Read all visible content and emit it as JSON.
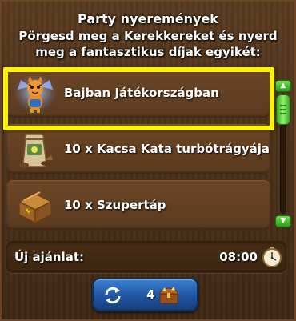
{
  "header": {
    "title": "Party nyeremények",
    "subtitle": "Pörgesd meg a Kerekkereket és nyerd meg a fantasztikus díjak egyikét:"
  },
  "prizes": [
    {
      "label": "Bajban Játékországban",
      "icon": "tiger-costume-icon",
      "selected": true
    },
    {
      "label": "10 x Kacsa Kata turbótrágyája",
      "icon": "fertilizer-sack-icon",
      "selected": false
    },
    {
      "label": "10 x Szupertáp",
      "icon": "super-feed-crate-icon",
      "selected": false
    }
  ],
  "offer": {
    "label": "Új ajánlat:",
    "time": "08:00",
    "icon": "stopwatch-icon"
  },
  "spin_button": {
    "count": "4",
    "icon": "refresh-icon",
    "cost_icon": "treasure-chest-icon"
  },
  "colors": {
    "highlight": "#fbf300",
    "scrollbar": "#3aa823",
    "button": "#1f56a3"
  }
}
